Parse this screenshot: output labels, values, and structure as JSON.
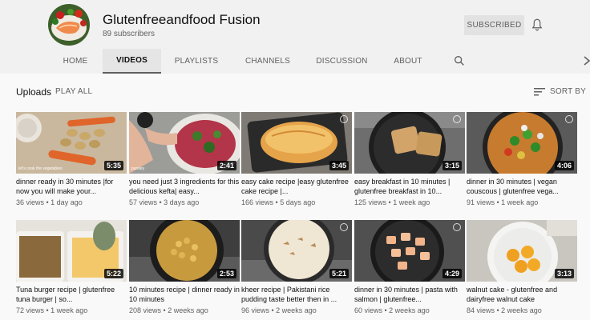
{
  "channel": {
    "name": "Glutenfreeandfood Fusion",
    "subscribers": "89 subscribers",
    "subscribed_label": "SUBSCRIBED"
  },
  "tabs": [
    {
      "label": "HOME",
      "active": false
    },
    {
      "label": "VIDEOS",
      "active": true
    },
    {
      "label": "PLAYLISTS",
      "active": false
    },
    {
      "label": "CHANNELS",
      "active": false
    },
    {
      "label": "DISCUSSION",
      "active": false
    },
    {
      "label": "ABOUT",
      "active": false
    }
  ],
  "icons": {
    "search": "search-icon",
    "bell": "bell-icon",
    "next": "chevron-right-icon",
    "sort": "sort-icon"
  },
  "section": {
    "title": "Uploads",
    "play_all": "PLAY ALL",
    "sort_by": "SORT BY"
  },
  "videos": [
    {
      "title": "dinner ready in 30 minutes |for now you will make your...",
      "views": "36 views",
      "age": "1 day ago",
      "duration": "5:35",
      "caption": "let's cook the vegetables"
    },
    {
      "title": "you need just 3 ingredients for this delicious kefta| easy...",
      "views": "57 views",
      "age": "3 days ago",
      "duration": "2:41",
      "caption": "parsley"
    },
    {
      "title": "easy cake recipe |easy glutenfree cake recipe |...",
      "views": "166 views",
      "age": "5 days ago",
      "duration": "3:45"
    },
    {
      "title": "easy breakfast in 10 minutes | glutenfree breakfast in 10...",
      "views": "125 views",
      "age": "1 week ago",
      "duration": "3:15"
    },
    {
      "title": "dinner in 30 minutes | vegan couscous | glutenfree vega...",
      "views": "91 views",
      "age": "1 week ago",
      "duration": "4:06"
    },
    {
      "title": "Tuna burger recipe | glutenfree tuna burger | so...",
      "views": "72 views",
      "age": "1 week ago",
      "duration": "5:22"
    },
    {
      "title": "10 minutes recipe | dinner ready in 10 minutes",
      "views": "208 views",
      "age": "2 weeks ago",
      "duration": "2:53"
    },
    {
      "title": "kheer recipe | Pakistani rice pudding taste better then in ...",
      "views": "96 views",
      "age": "2 weeks ago",
      "duration": "5:21"
    },
    {
      "title": "dinner in 30 minutes | pasta with salmon | glutenfree...",
      "views": "60 views",
      "age": "2 weeks ago",
      "duration": "4:29"
    },
    {
      "title": "walnut cake - glutenfree and dairyfree walnut cake",
      "views": "84 views",
      "age": "2 weeks ago",
      "duration": "3:13"
    }
  ]
}
